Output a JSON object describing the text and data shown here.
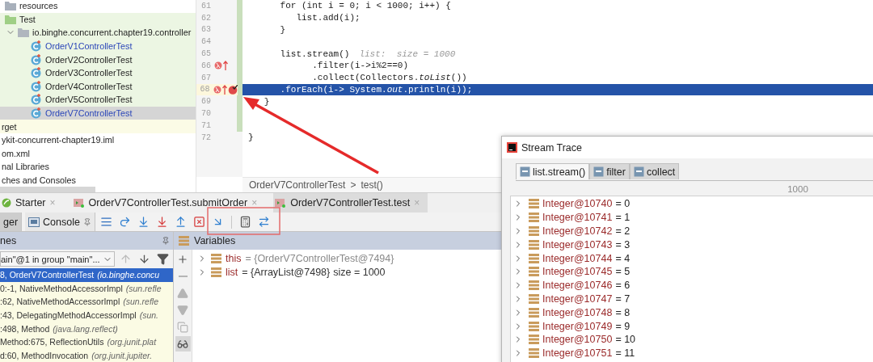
{
  "project_tree": [
    {
      "label": "resources",
      "kind": "resources",
      "selected": false
    },
    {
      "label": "Test",
      "kind": "test_folder",
      "selected": false,
      "children": [
        {
          "label": "io.binghe.concurrent.chapter19.controller",
          "kind": "package",
          "expanded": true,
          "selected": false,
          "children": [
            {
              "label": "OrderV1ControllerTest",
              "kind": "class",
              "modified": true,
              "selected": false
            },
            {
              "label": "OrderV2ControllerTest",
              "kind": "class",
              "modified": false,
              "selected": false
            },
            {
              "label": "OrderV3ControllerTest",
              "kind": "class",
              "modified": false,
              "selected": false
            },
            {
              "label": "OrderV4ControllerTest",
              "kind": "class",
              "modified": false,
              "selected": false
            },
            {
              "label": "OrderV5ControllerTest",
              "kind": "class",
              "modified": false,
              "selected": false
            },
            {
              "label": "OrderV7ControllerTest",
              "kind": "class",
              "modified": true,
              "selected": true
            }
          ]
        }
      ]
    },
    {
      "label": "rget",
      "kind": "excluded",
      "selected": false
    },
    {
      "label": "ykit-concurrent-chapter19.iml",
      "kind": "file",
      "selected": false
    },
    {
      "label": "om.xml",
      "kind": "file",
      "selected": false
    },
    {
      "label": "nal Libraries",
      "kind": "file",
      "selected": false
    },
    {
      "label": "ches and Consoles",
      "kind": "file",
      "selected": false
    }
  ],
  "editor": {
    "lines": [
      {
        "number": "61",
        "code": "      for (int i = 0; i < 1000; i++) {",
        "changed": true,
        "selected": false
      },
      {
        "number": "62",
        "code": "         list.add(i);",
        "changed": true,
        "selected": false
      },
      {
        "number": "63",
        "code": "      }",
        "changed": true,
        "selected": false
      },
      {
        "number": "64",
        "changed": true,
        "selected": false
      },
      {
        "number": "65",
        "code": "      list.stream()",
        "hint": "list:  size = 1000",
        "changed": true,
        "selected": false
      },
      {
        "number": "66",
        "code": "            .filter(i->i%2==0)",
        "markers": [
          {
            "kind": "lambda"
          },
          {
            "kind": "arrow"
          }
        ],
        "changed": true,
        "selected": false
      },
      {
        "number": "67",
        "code": "            .collect(Collectors.*toList*())",
        "changed": true,
        "selected": false
      },
      {
        "number": "68",
        "code": "      .forEach(i-> System.*out*.println(i));",
        "markers": [
          {
            "kind": "lambda"
          },
          {
            "kind": "arrow"
          },
          {
            "kind": "breakpoint"
          }
        ],
        "changed": true,
        "selected": true
      },
      {
        "number": "69",
        "code": "   }",
        "changed": true,
        "selected": false
      },
      {
        "number": "70",
        "changed": true,
        "selected": false
      },
      {
        "number": "71",
        "changed": true,
        "selected": false
      },
      {
        "number": "72",
        "code": "}",
        "changed": false,
        "selected": false
      }
    ],
    "breadcrumb": [
      "OrderV7ControllerTest",
      "test()"
    ],
    "breadcrumb_separator": ">"
  },
  "debug_tabs": [
    {
      "label": "Starter",
      "kind": "spring",
      "close": "×",
      "selected": false
    },
    {
      "label": "OrderV7ControllerTest.submitOrder",
      "kind": "test",
      "close": "×",
      "selected": false
    },
    {
      "label": "OrderV7ControllerTest.test",
      "kind": "test",
      "close": "×",
      "selected": true
    }
  ],
  "toolbar": {
    "tabs": [
      {
        "label": "ger",
        "kind": "debugger",
        "selected": true
      },
      {
        "label": "Console",
        "kind": "console",
        "selected": false
      }
    ],
    "buttons": [
      {
        "kind": "layout"
      },
      {
        "kind": "step_over"
      },
      {
        "kind": "step_into"
      },
      {
        "kind": "force_step_into"
      },
      {
        "kind": "step_out"
      },
      {
        "kind": "drop_frame"
      },
      {
        "kind": "run_to_cursor"
      },
      {
        "kind": "separator"
      },
      {
        "kind": "evaluate"
      },
      {
        "kind": "trace_stream"
      }
    ]
  },
  "frames": {
    "header": "nes",
    "thread": "ain\"@1 in group \"main\"...",
    "thread_buttons": [
      {
        "kind": "up",
        "disabled": true
      },
      {
        "kind": "down",
        "disabled": false
      },
      {
        "kind": "filter",
        "disabled": false
      }
    ],
    "rows": [
      {
        "text": "8, OrderV7ControllerTest",
        "package": "(io.binghe.concu",
        "selected": true
      },
      {
        "text": "0:-1, NativeMethodAccessorImpl",
        "package": "(sun.refle",
        "kind": "library",
        "selected": false
      },
      {
        "text": ":62, NativeMethodAccessorImpl",
        "package": "(sun.refle",
        "kind": "library",
        "selected": false
      },
      {
        "text": ":43, DelegatingMethodAccessorImpl",
        "package": "(sun.",
        "kind": "library",
        "selected": false
      },
      {
        "text": ":498, Method",
        "package": "(java.lang.reflect)",
        "kind": "library",
        "selected": false
      },
      {
        "text": "Method:675, ReflectionUtils",
        "package": "(org.junit.plat",
        "kind": "library",
        "selected": false
      },
      {
        "text": "d:60, MethodInvocation",
        "package": "(org.junit.jupiter.",
        "kind": "library",
        "selected": false
      }
    ]
  },
  "variables": {
    "header": "Variables",
    "side_buttons": [
      {
        "kind": "add",
        "disabled": false,
        "selected": false
      },
      {
        "kind": "remove",
        "disabled": true,
        "selected": false
      },
      {
        "kind": "up",
        "disabled": true,
        "selected": false
      },
      {
        "kind": "down",
        "disabled": true,
        "selected": false
      },
      {
        "kind": "copy",
        "disabled": true,
        "selected": false
      },
      {
        "kind": "watches",
        "disabled": false,
        "selected": true
      }
    ],
    "rows": [
      {
        "name": "this",
        "value": "= {OrderV7ControllerTest@7494}",
        "muted": true
      },
      {
        "name": "list",
        "value": "= {ArrayList@7498}",
        "extra": "size = 1000",
        "muted": false
      }
    ]
  },
  "stream_trace": {
    "title": "Stream Trace",
    "tabs": [
      {
        "label": "list.stream()",
        "selected": true
      },
      {
        "label": "filter",
        "selected": false
      },
      {
        "label": "collect",
        "selected": false
      }
    ],
    "count": "1000",
    "rows": [
      {
        "name": "Integer@10740",
        "value": "= 0"
      },
      {
        "name": "Integer@10741",
        "value": "= 1"
      },
      {
        "name": "Integer@10742",
        "value": "= 2"
      },
      {
        "name": "Integer@10743",
        "value": "= 3"
      },
      {
        "name": "Integer@10744",
        "value": "= 4"
      },
      {
        "name": "Integer@10745",
        "value": "= 5"
      },
      {
        "name": "Integer@10746",
        "value": "= 6"
      },
      {
        "name": "Integer@10747",
        "value": "= 7"
      },
      {
        "name": "Integer@10748",
        "value": "= 8"
      },
      {
        "name": "Integer@10749",
        "value": "= 9"
      },
      {
        "name": "Integer@10750",
        "value": "= 10"
      },
      {
        "name": "Integer@10751",
        "value": "= 11"
      }
    ]
  },
  "annotations": {
    "rectangle": true,
    "arrow": true
  }
}
